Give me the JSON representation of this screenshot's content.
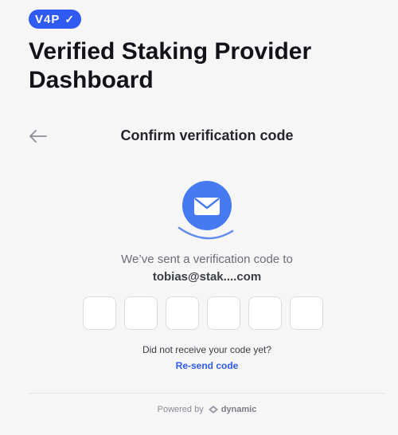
{
  "header": {
    "logo_text": "V4P",
    "logo_check": "✓",
    "title": "Verified Staking Provider Dashboard"
  },
  "card": {
    "title": "Confirm verification code",
    "sent_message": "We’ve sent a verification code to",
    "email": "tobias@stak....com",
    "code_inputs": [
      "",
      "",
      "",
      "",
      "",
      ""
    ],
    "no_code_message": "Did not receive your code yet?",
    "resend_label": "Re-send code"
  },
  "footer": {
    "powered_by": "Powered by",
    "brand": "dynamic"
  },
  "icons": {
    "back": "arrow-left-icon",
    "mail": "envelope-icon",
    "brand": "dynamic-logo-icon"
  },
  "colors": {
    "accent": "#2f5bf2",
    "mail_circle": "#4779f0",
    "background": "#f6f6f7"
  }
}
